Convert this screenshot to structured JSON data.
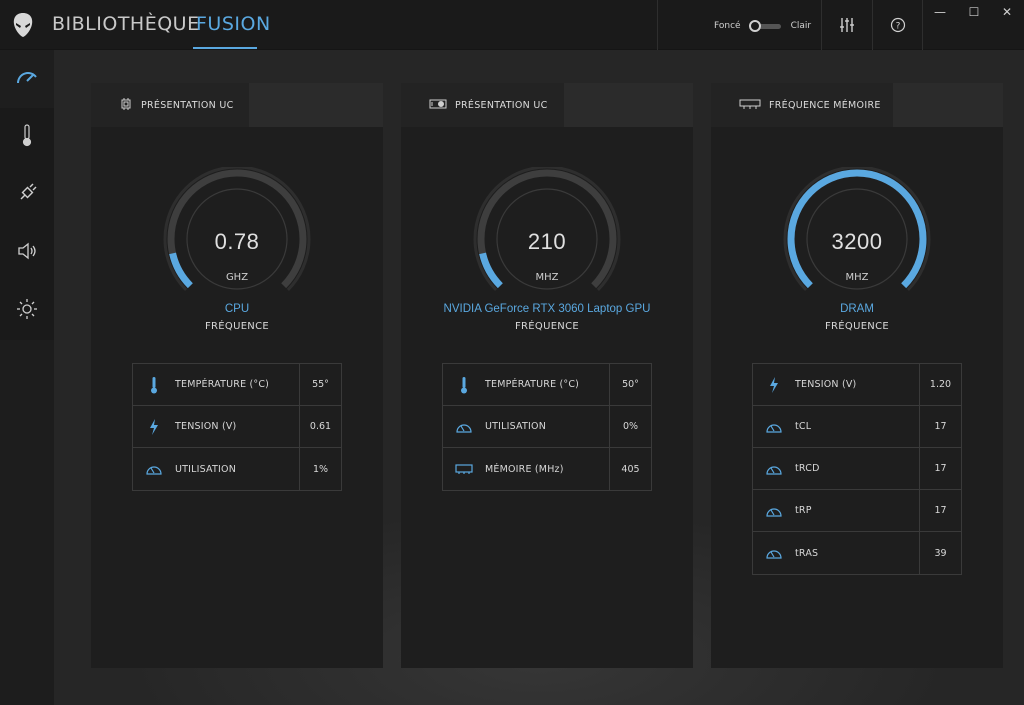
{
  "header": {
    "tabs": [
      {
        "label": "BIBLIOTHÈQUE",
        "active": false
      },
      {
        "label": "FUSION",
        "active": true
      }
    ],
    "theme": {
      "dark_label": "Foncé",
      "light_label": "Clair",
      "selected": "Foncé"
    },
    "icons": {
      "logo": "alien-head-icon",
      "settings": "sliders-icon",
      "help": "help-icon"
    },
    "window_controls": {
      "minimize": "—",
      "maximize": "☐",
      "close": "✕"
    },
    "accent_color": "#5aa8e0"
  },
  "sidebar": {
    "items": [
      {
        "icon": "speedometer-icon",
        "active": true
      },
      {
        "icon": "thermometer-icon",
        "active": false
      },
      {
        "icon": "power-plug-icon",
        "active": false
      },
      {
        "icon": "speaker-icon",
        "active": false
      },
      {
        "icon": "brightness-icon",
        "active": false
      }
    ]
  },
  "panels": [
    {
      "tab_icon": "cpu-chip-icon",
      "title": "PRÉSENTATION UC",
      "gauge": {
        "value": "0.78",
        "unit": "GHZ",
        "fill": 0.12
      },
      "device": "CPU",
      "caption": "FRÉQUENCE",
      "stats": [
        {
          "icon": "thermometer-icon",
          "label": "TEMPÉRATURE (°C)",
          "value": "55°"
        },
        {
          "icon": "lightning-icon",
          "label": "TENSION (V)",
          "value": "0.61"
        },
        {
          "icon": "gauge-icon",
          "label": "UTILISATION",
          "value": "1%"
        }
      ]
    },
    {
      "tab_icon": "graphics-card-icon",
      "title": "PRÉSENTATION UC",
      "gauge": {
        "value": "210",
        "unit": "MHZ",
        "fill": 0.12
      },
      "device": "NVIDIA GeForce RTX 3060 Laptop GPU",
      "caption": "FRÉQUENCE",
      "stats": [
        {
          "icon": "thermometer-icon",
          "label": "TEMPÉRATURE (°C)",
          "value": "50°"
        },
        {
          "icon": "gauge-icon",
          "label": "UTILISATION",
          "value": "0%"
        },
        {
          "icon": "memory-icon",
          "label": "MÉMOIRE (MHz)",
          "value": "405"
        }
      ]
    },
    {
      "tab_icon": "memory-module-icon",
      "title": "FRÉQUENCE MÉMOIRE",
      "gauge": {
        "value": "3200",
        "unit": "MHZ",
        "fill": 1.0
      },
      "device": "DRAM",
      "caption": "FRÉQUENCE",
      "stats": [
        {
          "icon": "lightning-icon",
          "label": "TENSION (V)",
          "value": "1.20"
        },
        {
          "icon": "gauge-icon",
          "label": "tCL",
          "value": "17"
        },
        {
          "icon": "gauge-icon",
          "label": "tRCD",
          "value": "17"
        },
        {
          "icon": "gauge-icon",
          "label": "tRP",
          "value": "17"
        },
        {
          "icon": "gauge-icon",
          "label": "tRAS",
          "value": "39"
        }
      ]
    }
  ]
}
